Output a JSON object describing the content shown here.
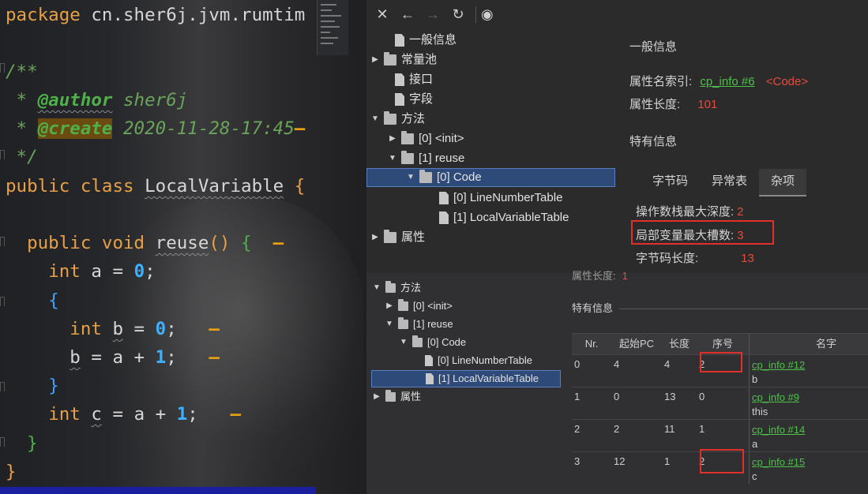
{
  "editor": {
    "lines": [
      "package cn.sher6j.jvm.rumtim",
      "",
      "/**",
      " * @author sher6j",
      " * @create 2020-11-28-17:45",
      " */",
      "public class LocalVariable {",
      "",
      "public void reuse() {",
      "int a = 0;",
      "{",
      "int b = 0;",
      "b = a + 1;",
      "}",
      "int c = a + 1;",
      "}",
      "}"
    ],
    "package_kw": "package",
    "package_name": "cn.sher6j.jvm.rumtim",
    "comment_open": "/**",
    "author_tag": "@author",
    "author_val": "sher6j",
    "create_tag": "@create",
    "create_val": "2020-11-28-17:45",
    "comment_close": "*/",
    "class_kw": "public class",
    "class_name": "LocalVariable",
    "method_kw": "public void",
    "method_name": "reuse",
    "int_kw": "int",
    "var_a": "a",
    "var_b": "b",
    "var_c": "c",
    "num_0": "0",
    "num_1": "1"
  },
  "toolbar": {
    "close": "✕",
    "back": "←",
    "forward": "→",
    "refresh": "↻",
    "globe": "◉"
  },
  "tree": {
    "items": [
      {
        "label": "一般信息"
      },
      {
        "label": "常量池"
      },
      {
        "label": "接口"
      },
      {
        "label": "字段"
      },
      {
        "label": "方法"
      },
      {
        "label": "[0] <init>"
      },
      {
        "label": "[1] reuse"
      },
      {
        "label": "[0] Code"
      },
      {
        "label": "[0] LineNumberTable"
      },
      {
        "label": "[1] LocalVariableTable"
      },
      {
        "label": "属性"
      }
    ]
  },
  "detail": {
    "general_title": "一般信息",
    "attr_name_label": "属性名索引:",
    "attr_name_link": "cp_info #6",
    "attr_name_value": "<Code>",
    "attr_len_label": "属性长度:",
    "attr_len_value": "101",
    "specific_title": "特有信息",
    "tabs": [
      "字节码",
      "异常表",
      "杂项"
    ],
    "max_stack_label": "操作数栈最大深度:",
    "max_stack_value": "2",
    "max_locals_label": "局部变量最大槽数:",
    "max_locals_value": "3",
    "code_len_label": "字节码长度:",
    "code_len_value": "13"
  },
  "inset": {
    "partial_label": "属性长度:",
    "specific_title": "特有信息",
    "tree": [
      {
        "label": "方法"
      },
      {
        "label": "[0] <init>"
      },
      {
        "label": "[1] reuse"
      },
      {
        "label": "[0] Code"
      },
      {
        "label": "[0] LineNumberTable"
      },
      {
        "label": "[1] LocalVariableTable"
      },
      {
        "label": "属性"
      }
    ],
    "table": {
      "headers": [
        "Nr.",
        "起始PC",
        "长度",
        "序号",
        "名字"
      ],
      "rows": [
        {
          "nr": "0",
          "start": "4",
          "len": "4",
          "idx": "2",
          "link": "cp_info #12",
          "name": "b"
        },
        {
          "nr": "1",
          "start": "0",
          "len": "13",
          "idx": "0",
          "link": "cp_info #9",
          "name": "this"
        },
        {
          "nr": "2",
          "start": "2",
          "len": "11",
          "idx": "1",
          "link": "cp_info #14",
          "name": "a"
        },
        {
          "nr": "3",
          "start": "12",
          "len": "1",
          "idx": "2",
          "link": "cp_info #15",
          "name": "c"
        }
      ]
    }
  }
}
